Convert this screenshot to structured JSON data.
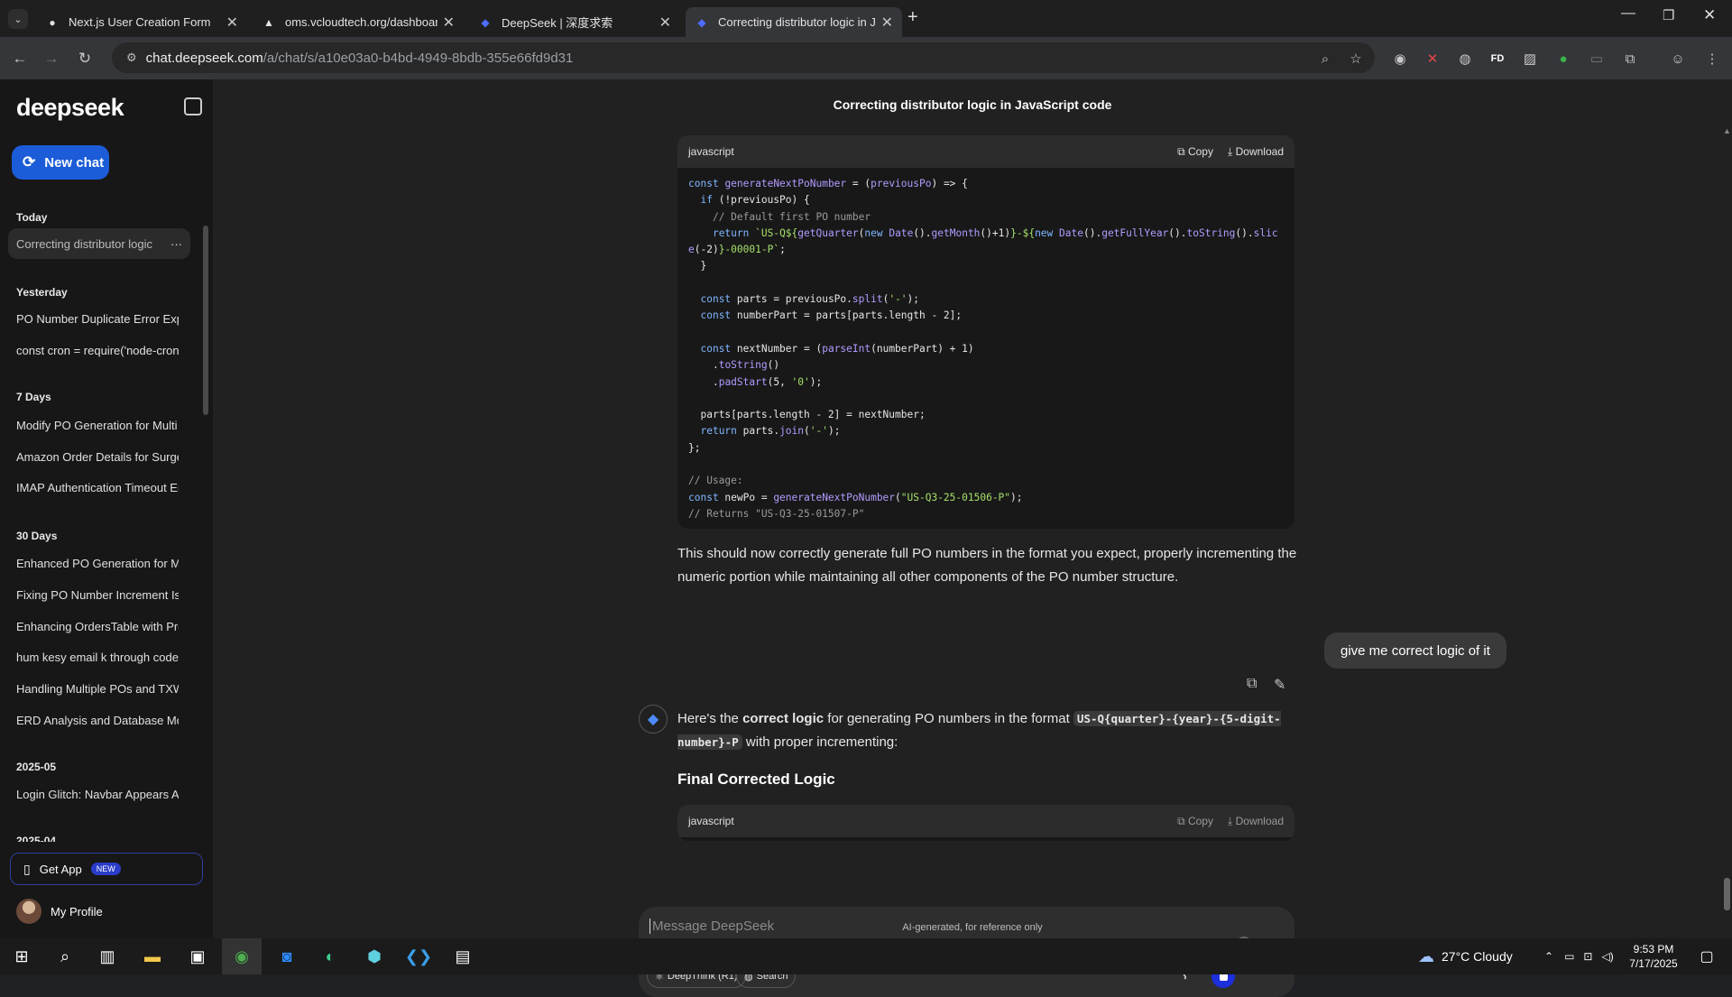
{
  "browser": {
    "tabs": [
      {
        "title": "Next.js User Creation Form",
        "icon": "github-icon"
      },
      {
        "title": "oms.vcloudtech.org/dashboard",
        "icon": "vercel-icon"
      },
      {
        "title": "DeepSeek | 深度求索",
        "icon": "deepseek-icon"
      },
      {
        "title": "Correcting distributor logic in Ja",
        "icon": "deepseek-icon"
      }
    ],
    "url_host": "chat.deepseek.com",
    "url_path": "/a/chat/s/a10e03a0-b4bd-4949-8bdb-355e66fd9d31"
  },
  "sidebar": {
    "logo": "deepseek",
    "new_chat": "New chat",
    "sections": [
      {
        "label": "Today",
        "items": [
          "Correcting distributor logic"
        ]
      },
      {
        "label": "Yesterday",
        "items": [
          "PO Number Duplicate Error Expl",
          "const cron = require('node-cron"
        ]
      },
      {
        "label": "7 Days",
        "items": [
          "Modify PO Generation for Multi",
          "Amazon Order Details for Surge",
          "IMAP Authentication Timeout Er"
        ]
      },
      {
        "label": "30 Days",
        "items": [
          "Enhanced PO Generation for Mu",
          "Fixing PO Number Increment Iss",
          "Enhancing OrdersTable with Pro",
          "hum kesy email k through code",
          "Handling Multiple POs and TXW",
          "ERD Analysis and Database Mod"
        ]
      },
      {
        "label": "2025-05",
        "items": [
          "Login Glitch: Navbar Appears Ab"
        ]
      },
      {
        "label": "2025-04",
        "items": []
      }
    ],
    "get_app": "Get App",
    "get_app_badge": "NEW",
    "profile": "My Profile"
  },
  "chat": {
    "title": "Correcting distributor logic in JavaScript code",
    "code1": {
      "lang": "javascript",
      "copy": "Copy",
      "download": "Download"
    },
    "paragraph1": "This should now correctly generate full PO numbers in the format you expect, properly incrementing the numeric portion while maintaining all other components of the PO number structure.",
    "user_message": "give me correct logic of it",
    "answer_pre": "Here's the ",
    "answer_bold": "correct logic",
    "answer_mid": " for generating PO numbers in the format ",
    "answer_code": "US-Q{quarter}-{year}-{5-digit-number}-P",
    "answer_post": " with proper incrementing:",
    "heading": "Final Corrected Logic",
    "code2": {
      "lang": "javascript",
      "copy": "Copy",
      "download": "Download"
    },
    "input_placeholder": "Message DeepSeek",
    "deepthink": "DeepThink (R1)",
    "search": "Search",
    "disclaimer": "AI-generated, for reference only"
  },
  "taskbar": {
    "weather": "27°C  Cloudy",
    "time": "9:53 PM",
    "date": "7/17/2025"
  }
}
